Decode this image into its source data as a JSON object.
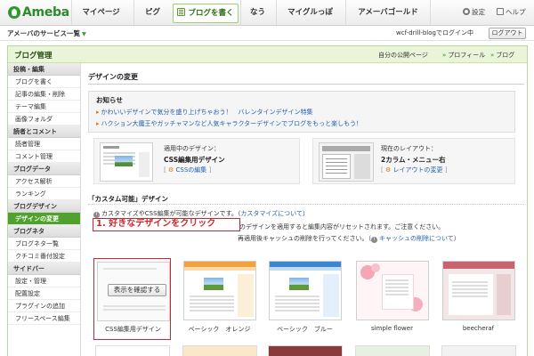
{
  "colors": {
    "brand_green": "#4fa22c",
    "link_blue": "#2060b0",
    "accent_orange": "#e07a00",
    "callout_red": "#d8232a"
  },
  "header": {
    "logo_text": "Ameba",
    "nav": [
      "マイページ",
      "ピグ",
      "ブログを書く",
      "なう",
      "マイグルっぽ",
      "アメーバゴールド"
    ],
    "active_nav": "ブログを書く",
    "settings_label": "設定",
    "help_label": "ヘルプ"
  },
  "subbar": {
    "services_label": "アメーバのサービス一覧",
    "login_status": "wcf-drill-blogでログイン中",
    "logout_label": "ログアウト"
  },
  "mgmt": {
    "title": "ブログ管理",
    "links": [
      "自分の公開ページ",
      "プロフィール",
      "ブログ"
    ]
  },
  "sidebar": {
    "groups": [
      {
        "header": "投稿・編集",
        "items": [
          "ブログを書く",
          "記事の編集・削除",
          "テーマ編集",
          "画像フォルダ"
        ]
      },
      {
        "header": "読者とコメント",
        "items": [
          "読者管理",
          "コメント管理"
        ]
      },
      {
        "header": "ブログデータ",
        "items": [
          "アクセス解析",
          "ランキング"
        ]
      },
      {
        "header": "ブログデザイン",
        "items": [
          "デザインの変更"
        ]
      },
      {
        "header": "ブログネタ",
        "items": [
          "ブログネタ一覧",
          "クチコミ番付設定"
        ]
      },
      {
        "header": "サイドバー",
        "items": [
          "設定・管理",
          "配置設定",
          "プラグインの追加",
          "フリースペース編集"
        ]
      }
    ],
    "selected": "デザインの変更"
  },
  "main": {
    "page_title": "デザインの変更",
    "news": {
      "heading": "お知らせ",
      "items": [
        "かわいいデザインで気分を盛り上げちゃおう！　バレンタインデザイン特集",
        "ハクション大魔王やガッチャマンなど人気キャラクターデザインでブログをもっと楽しもう！"
      ]
    },
    "current_design": {
      "label": "適用中のデザイン：",
      "value": "CSS編集用デザイン",
      "link": "CSSの編集"
    },
    "current_layout": {
      "label": "現在のレイアウト：",
      "value": "2カラム・メニュー右",
      "link": "レイアウトの変更"
    },
    "custom_section": {
      "title": "「カスタム可能」デザイン",
      "note1_pre": "カスタマイズやCSS編集が可能なデザインです。（",
      "note1_link": "カスタマイズについて",
      "note1_post": "）",
      "note2": "のデザインを適用すると編集内容がリセットされます。ご注意ください。",
      "note3_pre": "再適用後キャッシュの削除を行ってください。（",
      "note3_link": "キャッシュの削除について",
      "note3_post": "）"
    },
    "callout": "1. 好きなデザインをクリック",
    "confirm_button": "表示を確認する",
    "designs": [
      "CSS編集用デザイン",
      "ベーシック　オレンジ",
      "ベーシック　ブルー",
      "simple flower",
      "beecheraf"
    ]
  }
}
